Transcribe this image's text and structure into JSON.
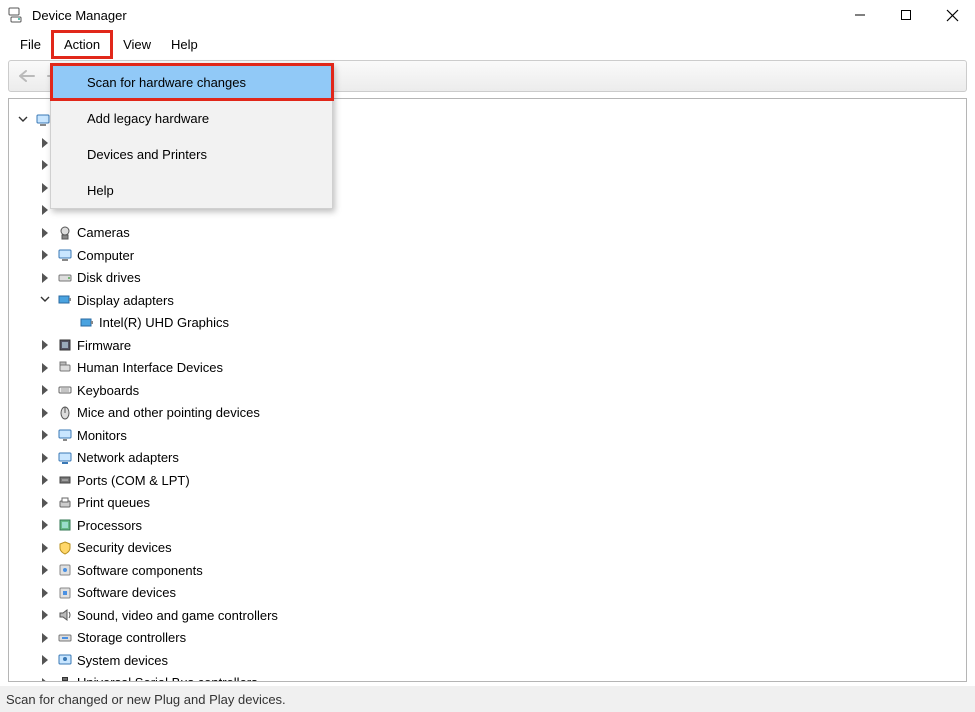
{
  "window": {
    "title": "Device Manager"
  },
  "menubar": {
    "file": "File",
    "action": "Action",
    "view": "View",
    "help": "Help"
  },
  "action_menu": {
    "scan": "Scan for hardware changes",
    "add_legacy": "Add legacy hardware",
    "devices_printers": "Devices and Printers",
    "help": "Help"
  },
  "tree": {
    "root": "",
    "display_adapters": "Display adapters",
    "display_child": "Intel(R) UHD Graphics",
    "nodes": [
      "",
      "",
      "",
      "",
      "",
      "Cameras",
      "Computer",
      "Disk drives"
    ],
    "after_display": [
      "Firmware",
      "Human Interface Devices",
      "Keyboards",
      "Mice and other pointing devices",
      "Monitors",
      "Network adapters",
      "Ports (COM & LPT)",
      "Print queues",
      "Processors",
      "Security devices",
      "Software components",
      "Software devices",
      "Sound, video and game controllers",
      "Storage controllers",
      "System devices",
      "Universal Serial Bus controllers"
    ]
  },
  "status": "Scan for changed or new Plug and Play devices."
}
